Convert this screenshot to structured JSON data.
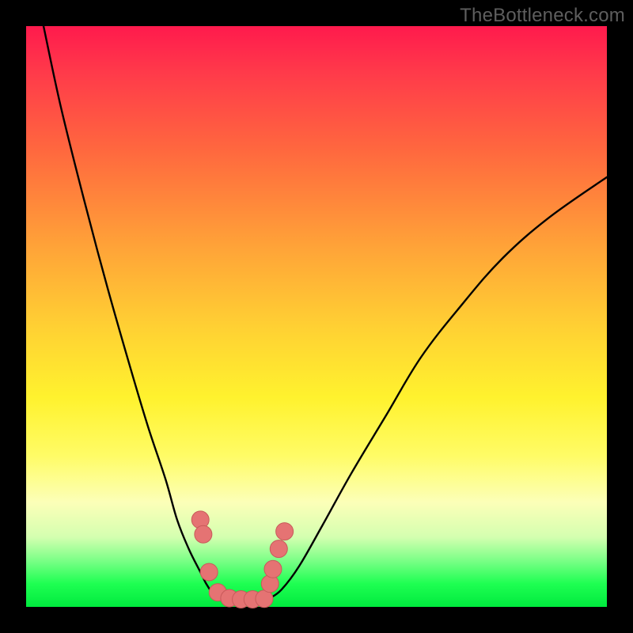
{
  "watermark": "TheBottleneck.com",
  "chart_data": {
    "type": "line",
    "title": "",
    "xlabel": "",
    "ylabel": "",
    "xlim": [
      0,
      100
    ],
    "ylim": [
      0,
      100
    ],
    "grid": false,
    "legend": false,
    "series": [
      {
        "name": "left-curve",
        "x": [
          3,
          6,
          10,
          14,
          18,
          21,
          24,
          26,
          28,
          30,
          31,
          32,
          33
        ],
        "y": [
          100,
          86,
          70,
          55,
          41,
          31,
          22,
          15,
          10,
          6,
          4,
          2.5,
          1.5
        ]
      },
      {
        "name": "right-curve",
        "x": [
          42,
          44,
          47,
          51,
          56,
          62,
          68,
          75,
          82,
          90,
          100
        ],
        "y": [
          1.5,
          3,
          7,
          14,
          23,
          33,
          43,
          52,
          60,
          67,
          74
        ]
      },
      {
        "name": "markers-left",
        "x": [
          30,
          30.5,
          31.5,
          33,
          35,
          37,
          39
        ],
        "y": [
          15,
          12.5,
          6,
          2.5,
          1.5,
          1.3,
          1.3
        ]
      },
      {
        "name": "markers-right",
        "x": [
          41,
          42,
          42.5,
          43.5,
          44.5
        ],
        "y": [
          1.4,
          4,
          6.5,
          10,
          13
        ]
      }
    ],
    "colors": {
      "curve": "#000000",
      "marker_fill": "#e57373",
      "marker_stroke": "#c85a5a"
    }
  }
}
